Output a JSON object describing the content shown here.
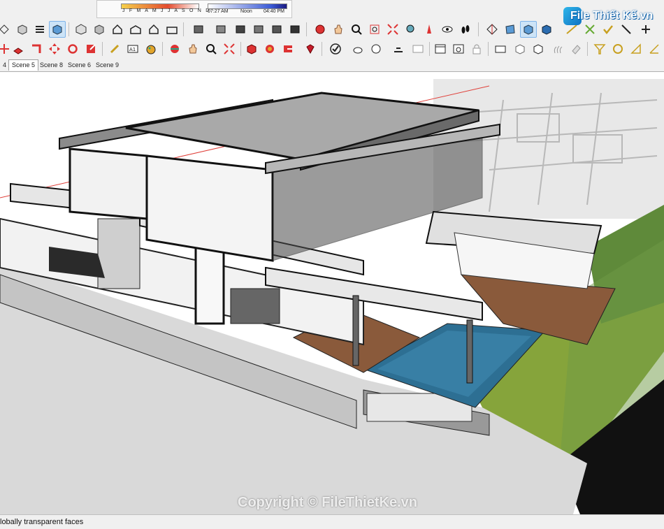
{
  "shadow": {
    "months": "J F M A M J J A S O N D",
    "sunrise": "07:27 AM",
    "noon": "Noon",
    "sunset": "04:40 PM"
  },
  "brand": {
    "logo_text": "File Thiết Kế.vn"
  },
  "tabs": [
    {
      "label": "4",
      "active": false
    },
    {
      "label": "Scene 5",
      "active": true
    },
    {
      "label": "Scene 8",
      "active": false
    },
    {
      "label": "Scene 6",
      "active": false
    },
    {
      "label": "Scene 9",
      "active": false
    }
  ],
  "status": {
    "text": "lobally transparent faces"
  },
  "watermark": "Copyright © FileThietKe.vn",
  "colors": {
    "accent": "#2fb6ea",
    "pool": "#2d6f93",
    "grass": "#86a43b",
    "deck": "#8a5a3b"
  }
}
